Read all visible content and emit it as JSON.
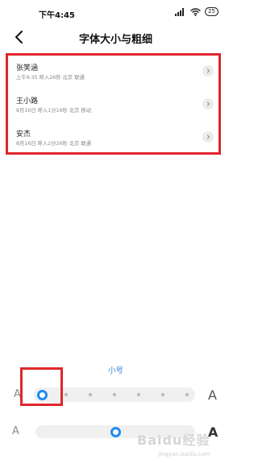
{
  "status_bar": {
    "time": "下午4:45",
    "battery": "25",
    "icons": [
      "signal-icon",
      "wifi-icon",
      "battery-icon"
    ]
  },
  "header": {
    "title": "字体大小与粗细"
  },
  "preview_items": [
    {
      "name": "张笑涵",
      "sub": "上午9:35 呼入26秒 北京 联通"
    },
    {
      "name": "王小路",
      "sub": "8月16日 呼入1分16秒 北京 移动"
    },
    {
      "name": "安杰",
      "sub": "8月16日 呼入2分26秒 北京 联通"
    }
  ],
  "font_size": {
    "label": "小号",
    "small_glyph": "A",
    "large_glyph": "A",
    "selected_index": 0,
    "steps": 7
  },
  "font_weight": {
    "small_glyph": "A",
    "large_glyph": "A",
    "level": 0.5
  },
  "watermark": {
    "text": "Baidu经验",
    "url": "jingyan.baidu.com"
  },
  "colors": {
    "accent": "#1f8bf2",
    "highlight": "#e0262c"
  }
}
